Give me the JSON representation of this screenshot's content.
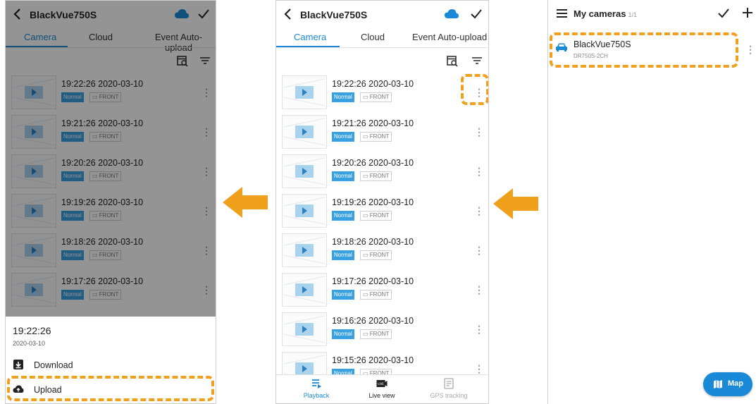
{
  "screens": {
    "left": {
      "title": "BlackVue750S",
      "tabs": [
        "Camera",
        "Cloud",
        "Event Auto-upload"
      ],
      "recordings": [
        {
          "time": "19:22:26  2020-03-10",
          "badge": "Normal",
          "camera": "FRONT"
        },
        {
          "time": "19:21:26  2020-03-10",
          "badge": "Normal",
          "camera": "FRONT"
        },
        {
          "time": "19:20:26  2020-03-10",
          "badge": "Normal",
          "camera": "FRONT"
        },
        {
          "time": "19:19:26  2020-03-10",
          "badge": "Normal",
          "camera": "FRONT"
        },
        {
          "time": "19:18:26  2020-03-10",
          "badge": "Normal",
          "camera": "FRONT"
        },
        {
          "time": "19:17:26  2020-03-10",
          "badge": "Normal",
          "camera": "FRONT"
        }
      ],
      "sheet": {
        "time": "19:22:26",
        "date": "2020-03-10",
        "download_label": "Download",
        "upload_label": "Upload"
      }
    },
    "middle": {
      "title": "BlackVue750S",
      "tabs": [
        "Camera",
        "Cloud",
        "Event Auto-upload"
      ],
      "recordings": [
        {
          "time": "19:22:26  2020-03-10",
          "badge": "Normal",
          "camera": "FRONT"
        },
        {
          "time": "19:21:26  2020-03-10",
          "badge": "Normal",
          "camera": "FRONT"
        },
        {
          "time": "19:20:26  2020-03-10",
          "badge": "Normal",
          "camera": "FRONT"
        },
        {
          "time": "19:19:26  2020-03-10",
          "badge": "Normal",
          "camera": "FRONT"
        },
        {
          "time": "19:18:26  2020-03-10",
          "badge": "Normal",
          "camera": "FRONT"
        },
        {
          "time": "19:17:26  2020-03-10",
          "badge": "Normal",
          "camera": "FRONT"
        },
        {
          "time": "19:16:26  2020-03-10",
          "badge": "Normal",
          "camera": "FRONT"
        },
        {
          "time": "19:15:26  2020-03-10",
          "badge": "Normal",
          "camera": "FRONT"
        }
      ],
      "bottom_nav": [
        "Playback",
        "Live view",
        "GPS tracking"
      ]
    },
    "right": {
      "title": "My cameras",
      "count": "1/1",
      "camera_name": "BlackVue750S",
      "camera_model": "DR750S-2CH",
      "map_label": "Map"
    }
  },
  "icons": {
    "back": "chevron-left-icon",
    "cloud": "cloud-icon",
    "check": "check-icon",
    "calendar_search": "calendar-search-icon",
    "filter": "filter-icon",
    "kebab": "more-vertical-icon",
    "download": "download-icon",
    "upload": "cloud-upload-icon",
    "arrow": "arrow-left-icon",
    "menu": "hamburger-menu-icon",
    "plus": "plus-icon",
    "car": "car-icon",
    "map": "map-icon"
  },
  "colors": {
    "accent": "#1a8ad8",
    "badge": "#3aa1e0",
    "highlight": "#f0a01c",
    "arrow": "#f0a01c",
    "overlay": "#000000"
  }
}
